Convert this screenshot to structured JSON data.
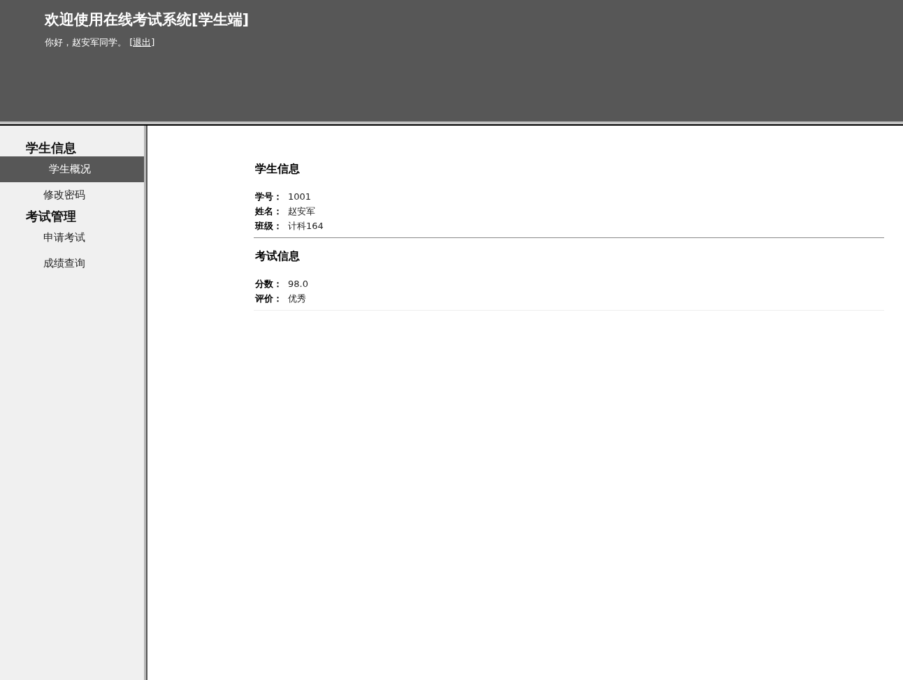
{
  "header": {
    "title": "欢迎使用在线考试系统[学生端]",
    "greeting": "你好，赵安军同学。 [",
    "logout_link": "退出",
    "greeting_end": "]"
  },
  "sidebar": {
    "groups": [
      {
        "title": "学生信息",
        "items": [
          {
            "label": "学生概况",
            "selected": true
          },
          {
            "label": "修改密码",
            "selected": false
          }
        ]
      },
      {
        "title": "考试管理",
        "items": [
          {
            "label": "申请考试",
            "selected": false
          },
          {
            "label": "成绩查询",
            "selected": false
          }
        ]
      }
    ]
  },
  "sections": [
    {
      "title": "学生信息",
      "fields": [
        {
          "label": "学号：",
          "value": "1001"
        },
        {
          "label": "姓名：",
          "value": "赵安军"
        },
        {
          "label": "班级：",
          "value": "计科164"
        }
      ]
    },
    {
      "title": "考试信息",
      "fields": [
        {
          "label": "分数：",
          "value": "98.0"
        },
        {
          "label": "评价：",
          "value": "优秀"
        }
      ]
    }
  ]
}
